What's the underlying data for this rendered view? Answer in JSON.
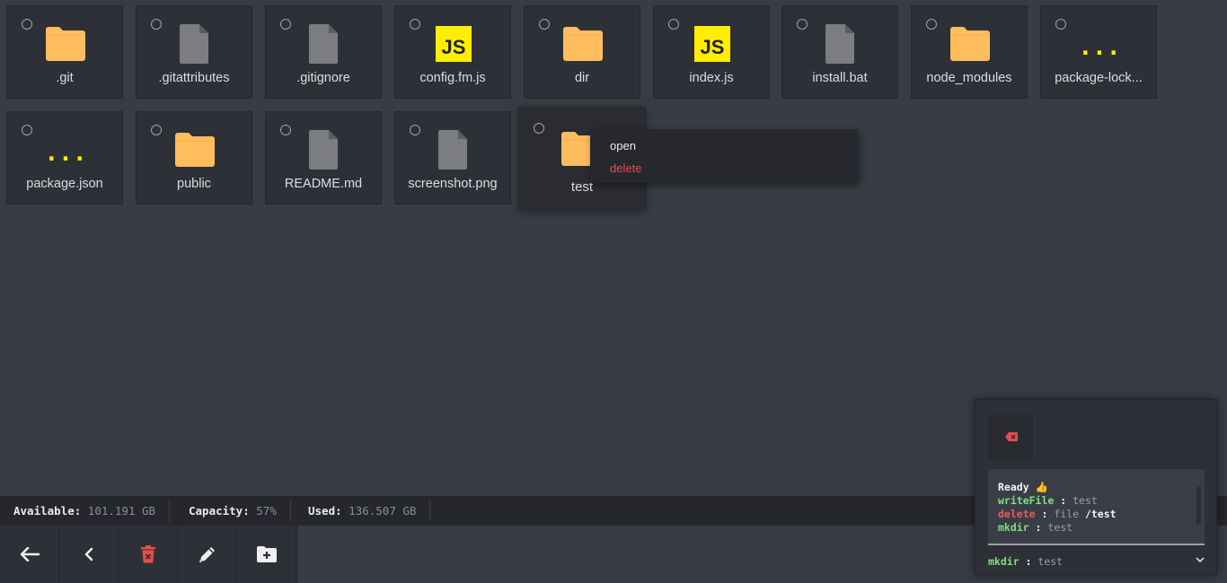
{
  "files": [
    {
      "name": ".git",
      "type": "folder"
    },
    {
      "name": ".gitattributes",
      "type": "file"
    },
    {
      "name": ".gitignore",
      "type": "file"
    },
    {
      "name": "config.fm.js",
      "type": "js"
    },
    {
      "name": "dir",
      "type": "folder"
    },
    {
      "name": "index.js",
      "type": "js"
    },
    {
      "name": "install.bat",
      "type": "file"
    },
    {
      "name": "node_modules",
      "type": "folder"
    },
    {
      "name": "package-lock...",
      "type": "json"
    },
    {
      "name": "package.json",
      "type": "json"
    },
    {
      "name": "public",
      "type": "folder"
    },
    {
      "name": "README.md",
      "type": "file"
    },
    {
      "name": "screenshot.png",
      "type": "file"
    },
    {
      "name": "test",
      "type": "folder"
    }
  ],
  "icon_text": {
    "js": "JS",
    "json": "{...}"
  },
  "context_menu": {
    "open_label": "open",
    "delete_label": "delete"
  },
  "status": {
    "available_label": "Available:",
    "available_value": "101.191 GB",
    "capacity_label": "Capacity:",
    "capacity_value": "57%",
    "used_label": "Used:",
    "used_value": "136.507 GB"
  },
  "toolbar": {
    "buttons": [
      "arrow-left-icon",
      "chevron-left-icon",
      "trash-icon",
      "pencil-icon",
      "new-folder-icon"
    ]
  },
  "console": {
    "log": [
      {
        "parts": [
          {
            "t": "Ready 👍",
            "c": "white"
          }
        ]
      },
      {
        "parts": [
          {
            "t": "writeFile",
            "c": "green"
          },
          {
            "t": " : ",
            "c": "bright"
          },
          {
            "t": "test",
            "c": "grey"
          }
        ]
      },
      {
        "parts": [
          {
            "t": "delete",
            "c": "red"
          },
          {
            "t": " : ",
            "c": "bright"
          },
          {
            "t": "file ",
            "c": "grey"
          },
          {
            "t": "/test",
            "c": "bright"
          }
        ]
      },
      {
        "parts": [
          {
            "t": "mkdir",
            "c": "green"
          },
          {
            "t": " : ",
            "c": "bright"
          },
          {
            "t": "test",
            "c": "grey"
          }
        ]
      }
    ],
    "last_command": "mkdir",
    "last_sep": " : ",
    "last_arg": "test"
  },
  "colors": {
    "folder": "#ffbd5e",
    "file": "#7b7d81",
    "js_bg": "#ffee00",
    "js_text": "#222222",
    "json": "#ffee00",
    "danger": "#e74c4c",
    "success": "#7fe07f"
  }
}
